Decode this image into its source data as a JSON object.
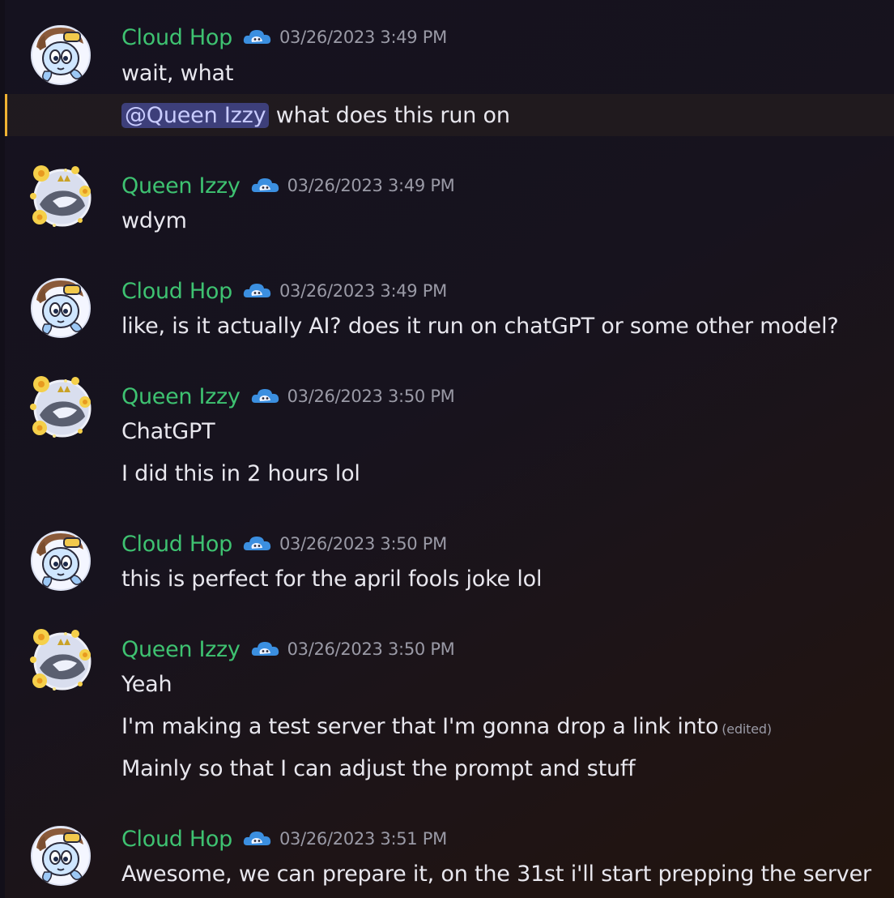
{
  "colors": {
    "author_name": "#3ec271",
    "timestamp": "#9a9aa6",
    "message_text": "#e8e7ee",
    "mention_bg": "#3d3f7a",
    "mention_text": "#c9ccff",
    "highlight_bar": "#f0b232"
  },
  "messages": [
    {
      "author": "Cloud Hop",
      "role_icon": "blue-cloud-icon",
      "timestamp": "03/26/2023 3:49 PM",
      "lines": [
        "wait, what",
        {
          "mention": "@Queen Izzy",
          "text": " what does this run on"
        }
      ]
    },
    {
      "author": "Queen Izzy",
      "role_icon": "blue-cloud-icon",
      "timestamp": "03/26/2023 3:49 PM",
      "lines": [
        "wdym"
      ]
    },
    {
      "author": "Cloud Hop",
      "role_icon": "blue-cloud-icon",
      "timestamp": "03/26/2023 3:49 PM",
      "lines": [
        "like, is it actually AI? does it run on chatGPT or some other model?"
      ]
    },
    {
      "author": "Queen Izzy",
      "role_icon": "blue-cloud-icon",
      "timestamp": "03/26/2023 3:50 PM",
      "lines": [
        "ChatGPT",
        "I did this in 2 hours lol"
      ]
    },
    {
      "author": "Cloud Hop",
      "role_icon": "blue-cloud-icon",
      "timestamp": "03/26/2023 3:50 PM",
      "lines": [
        "this is perfect for the april fools joke lol"
      ]
    },
    {
      "author": "Queen Izzy",
      "role_icon": "blue-cloud-icon",
      "timestamp": "03/26/2023 3:50 PM",
      "lines": [
        "Yeah",
        {
          "text": "I'm making a test server that I'm gonna drop a link into",
          "edited": "(edited)"
        },
        "Mainly so that I can adjust the prompt and stuff"
      ]
    },
    {
      "author": "Cloud Hop",
      "role_icon": "blue-cloud-icon",
      "timestamp": "03/26/2023 3:51 PM",
      "lines": [
        "Awesome, we can prepare it, on the 31st i'll start prepping the server"
      ]
    }
  ]
}
